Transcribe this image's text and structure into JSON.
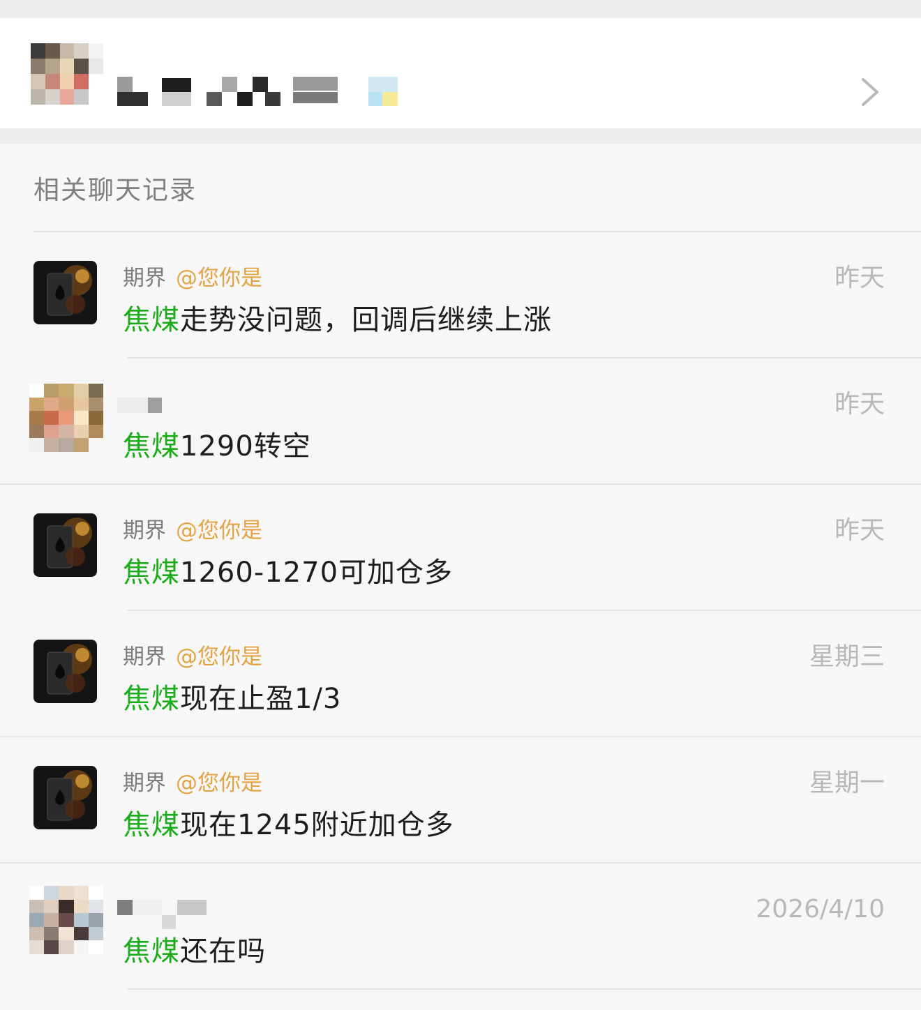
{
  "section": {
    "title": "相关聊天记录"
  },
  "results": [
    {
      "sender": "期界",
      "mention": "@您你是",
      "time": "昨天",
      "keyword": "焦煤",
      "text": "走势没问题，回调后继续上涨"
    },
    {
      "sender": "",
      "mention": "",
      "time": "昨天",
      "keyword": "焦煤",
      "text": "1290转空"
    },
    {
      "sender": "期界",
      "mention": "@您你是",
      "time": "昨天",
      "keyword": "焦煤",
      "text": "1260-1270可加仓多"
    },
    {
      "sender": "期界",
      "mention": "@您你是",
      "time": "星期三",
      "keyword": "焦煤",
      "text": "现在止盈1/3"
    },
    {
      "sender": "期界",
      "mention": "@您你是",
      "time": "星期一",
      "keyword": "焦煤",
      "text": "现在1245附近加仓多"
    },
    {
      "sender": "",
      "mention": "",
      "time": "2026/4/10",
      "keyword": "焦煤",
      "text": "还在吗"
    }
  ],
  "colors": {
    "keyword": "#1aad19",
    "mention": "#e4a342",
    "time": "#b8b8b8"
  }
}
